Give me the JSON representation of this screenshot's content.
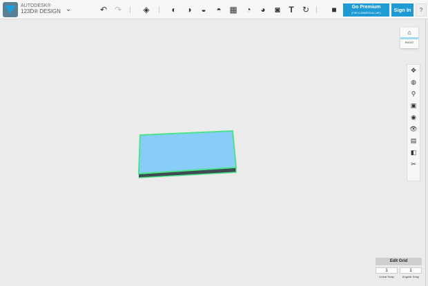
{
  "app": {
    "brand_top": "AUTODESK®",
    "brand_name": "123D® DESIGN"
  },
  "toolbar": {
    "tools": [
      {
        "name": "undo-icon",
        "glyph": "↶"
      },
      {
        "name": "redo-icon",
        "glyph": "↷"
      },
      {
        "name": "primitives-icon",
        "glyph": "◈"
      },
      {
        "name": "sketch-icon",
        "glyph": "◐"
      },
      {
        "name": "construct-icon",
        "glyph": "◑"
      },
      {
        "name": "modify-icon",
        "glyph": "◒"
      },
      {
        "name": "pattern-icon",
        "glyph": "◓"
      },
      {
        "name": "grouping-icon",
        "glyph": "▦"
      },
      {
        "name": "combine-icon",
        "glyph": "◔"
      },
      {
        "name": "measure-icon",
        "glyph": "◕"
      },
      {
        "name": "snap-icon",
        "glyph": "◙"
      },
      {
        "name": "text-icon",
        "glyph": "T"
      },
      {
        "name": "material-icon",
        "glyph": "↻"
      },
      {
        "name": "box-icon",
        "glyph": "■"
      }
    ],
    "premium_label": "Go Premium",
    "premium_sub": "(FOR COMMERCIAL USE)",
    "signin_label": "Sign In",
    "help_label": "?"
  },
  "viewcube": {
    "face_label": "RIGHT"
  },
  "nav_tools": [
    "pan-icon",
    "orbit-icon",
    "zoom-icon",
    "fit-icon",
    "views-icon",
    "visibility-icon",
    "grid-icon",
    "material-icon",
    "physical-icon"
  ],
  "grid": {
    "edit_label": "Edit Grid",
    "linear_value": "1",
    "angular_value": "1",
    "linear_label": "Linear Snap",
    "angular_label": "Angular Snap"
  },
  "colors": {
    "accent": "#1e9bd4",
    "object_top": "#87cdf7",
    "object_outline": "#4be38a",
    "object_side": "#3f4b52"
  }
}
